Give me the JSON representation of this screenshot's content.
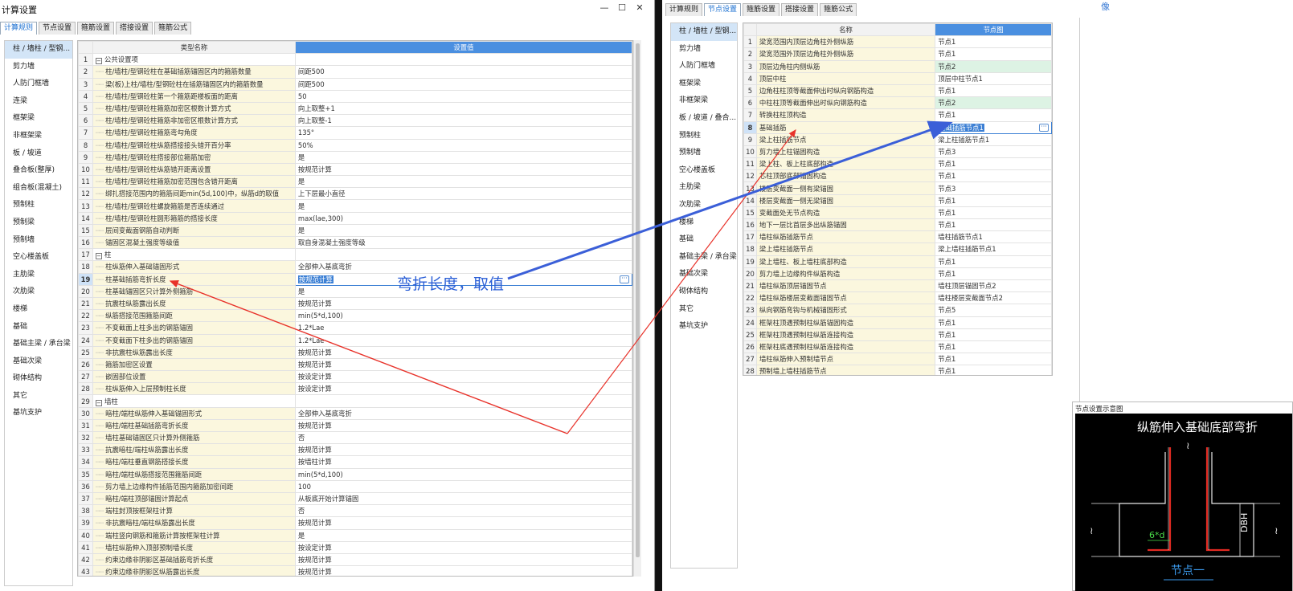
{
  "left_window": {
    "title": "计算设置",
    "controls": [
      "—",
      "☐",
      "✕"
    ],
    "tabs": [
      {
        "label": "计算规则",
        "active": true
      },
      {
        "label": "节点设置",
        "active": false
      },
      {
        "label": "箍筋设置",
        "active": false
      },
      {
        "label": "搭接设置",
        "active": false
      },
      {
        "label": "箍筋公式",
        "active": false
      }
    ],
    "sidebar": [
      "柱 / 墙柱 / 型钢...",
      "剪力墙",
      "人防门框墙",
      "连梁",
      "框架梁",
      "非框架梁",
      "板 / 坡道",
      "叠合板(整厚)",
      "组合板(混凝土)",
      "预制柱",
      "预制梁",
      "预制墙",
      "空心楼盖板",
      "主肋梁",
      "次肋梁",
      "楼梯",
      "基础",
      "基础主梁 / 承台梁",
      "基础次梁",
      "砌体结构",
      "其它",
      "基坑支护"
    ],
    "grid": {
      "col_name": "类型名称",
      "col_value": "设置值",
      "rows": [
        {
          "n": "1",
          "name": "公共设置项",
          "val": "",
          "group": true
        },
        {
          "n": "2",
          "name": "柱/墙柱/型钢砼柱在基础插筋锚固区内的箍筋数量",
          "val": "间距500"
        },
        {
          "n": "3",
          "name": "梁(板)上柱/墙柱/型钢砼柱在插筋锚固区内的箍筋数量",
          "val": "间距500"
        },
        {
          "n": "4",
          "name": "柱/墙柱/型钢砼柱第一个箍筋距楼板面的距离",
          "val": "50"
        },
        {
          "n": "5",
          "name": "柱/墙柱/型钢砼柱箍筋加密区根数计算方式",
          "val": "向上取整+1"
        },
        {
          "n": "6",
          "name": "柱/墙柱/型钢砼柱箍筋非加密区根数计算方式",
          "val": "向上取整-1"
        },
        {
          "n": "7",
          "name": "柱/墙柱/型钢砼柱箍筋弯勾角度",
          "val": "135°"
        },
        {
          "n": "8",
          "name": "柱/墙柱/型钢砼柱纵筋搭接接头错开百分率",
          "val": "50%"
        },
        {
          "n": "9",
          "name": "柱/墙柱/型钢砼柱搭接部位箍筋加密",
          "val": "是"
        },
        {
          "n": "10",
          "name": "柱/墙柱/型钢砼柱纵筋错开距离设置",
          "val": "按规范计算"
        },
        {
          "n": "11",
          "name": "柱/墙柱/型钢砼柱箍筋加密范围包含错开距离",
          "val": "是"
        },
        {
          "n": "12",
          "name": "绑扎搭接范围内的箍筋间距min(5d,100)中，纵筋d的取值",
          "val": "上下层最小直径"
        },
        {
          "n": "13",
          "name": "柱/墙柱/型钢砼柱螺旋箍筋是否连续通过",
          "val": "是"
        },
        {
          "n": "14",
          "name": "柱/墙柱/型钢砼柱圆形箍筋的搭接长度",
          "val": "max(lae,300)"
        },
        {
          "n": "15",
          "name": "层间变截面钢筋自动判断",
          "val": "是"
        },
        {
          "n": "16",
          "name": "锚固区混凝土强度等级值",
          "val": "取自身混凝土强度等级"
        },
        {
          "n": "17",
          "name": "柱",
          "val": "",
          "group": true
        },
        {
          "n": "18",
          "name": "柱纵筋伸入基础锚固形式",
          "val": "全部伸入基底弯折"
        },
        {
          "n": "19",
          "name": "柱基础插筋弯折长度",
          "val": "按规范计算",
          "selected": true
        },
        {
          "n": "20",
          "name": "柱基础锚固区只计算外侧箍筋",
          "val": "是"
        },
        {
          "n": "21",
          "name": "抗震柱纵筋露出长度",
          "val": "按规范计算"
        },
        {
          "n": "22",
          "name": "纵筋搭接范围箍筋间距",
          "val": "min(5*d,100)"
        },
        {
          "n": "23",
          "name": "不变截面上柱多出的钢筋锚固",
          "val": "1.2*Lae"
        },
        {
          "n": "24",
          "name": "不变截面下柱多出的钢筋锚固",
          "val": "1.2*Lae"
        },
        {
          "n": "25",
          "name": "非抗震柱纵筋露出长度",
          "val": "按规范计算"
        },
        {
          "n": "26",
          "name": "箍筋加密区设置",
          "val": "按规范计算"
        },
        {
          "n": "27",
          "name": "嵌固部位设置",
          "val": "按设定计算"
        },
        {
          "n": "28",
          "name": "柱纵筋伸入上层预制柱长度",
          "val": "按设定计算"
        },
        {
          "n": "29",
          "name": "墙柱",
          "val": "",
          "group": true
        },
        {
          "n": "30",
          "name": "暗柱/端柱纵筋伸入基础锚固形式",
          "val": "全部伸入基底弯折"
        },
        {
          "n": "31",
          "name": "暗柱/端柱基础插筋弯折长度",
          "val": "按规范计算"
        },
        {
          "n": "32",
          "name": "墙柱基础锚固区只计算外侧箍筋",
          "val": "否"
        },
        {
          "n": "33",
          "name": "抗震暗柱/端柱纵筋露出长度",
          "val": "按规范计算"
        },
        {
          "n": "34",
          "name": "暗柱/端柱垂直钢筋搭接长度",
          "val": "按墙柱计算"
        },
        {
          "n": "35",
          "name": "暗柱/端柱纵筋搭接范围箍筋间距",
          "val": "min(5*d,100)"
        },
        {
          "n": "36",
          "name": "剪力墙上边缘构件插筋范围内箍筋加密间距",
          "val": "100"
        },
        {
          "n": "37",
          "name": "暗柱/端柱顶部锚固计算起点",
          "val": "从板底开始计算锚固"
        },
        {
          "n": "38",
          "name": "端柱封顶按框架柱计算",
          "val": "否"
        },
        {
          "n": "39",
          "name": "非抗震暗柱/端柱纵筋露出长度",
          "val": "按规范计算"
        },
        {
          "n": "40",
          "name": "端柱竖向钢筋和箍筋计算按框架柱计算",
          "val": "是"
        },
        {
          "n": "41",
          "name": "墙柱纵筋伸入顶部预制墙长度",
          "val": "按设定计算"
        },
        {
          "n": "42",
          "name": "约束边缘非阴影区基础插筋弯折长度",
          "val": "按规范计算"
        },
        {
          "n": "43",
          "name": "约束边缘非阴影区纵筋露出长度",
          "val": "按规范计算"
        }
      ]
    }
  },
  "right_window": {
    "corner_text": "像",
    "tabs": [
      {
        "label": "计算规则",
        "active": false
      },
      {
        "label": "节点设置",
        "active": true
      },
      {
        "label": "箍筋设置",
        "active": false
      },
      {
        "label": "搭接设置",
        "active": false
      },
      {
        "label": "箍筋公式",
        "active": false
      }
    ],
    "sidebar": [
      "柱 / 墙柱 / 型钢...",
      "剪力墙",
      "人防门框墙",
      "框架梁",
      "非框架梁",
      "板 / 坡道 / 叠合...",
      "预制柱",
      "预制墙",
      "空心楼盖板",
      "主肋梁",
      "次肋梁",
      "楼梯",
      "基础",
      "基础主梁 / 承台梁",
      "基础次梁",
      "砌体结构",
      "其它",
      "基坑支护"
    ],
    "grid": {
      "col_name": "名称",
      "col_value": "节点图",
      "rows": [
        {
          "n": "1",
          "name": "梁宽范围内顶层边角柱外侧纵筋",
          "val": "节点1"
        },
        {
          "n": "2",
          "name": "梁宽范围外顶层边角柱外侧纵筋",
          "val": "节点1"
        },
        {
          "n": "3",
          "name": "顶层边角柱内侧纵筋",
          "val": "节点2",
          "green": true
        },
        {
          "n": "4",
          "name": "顶层中柱",
          "val": "顶层中柱节点1"
        },
        {
          "n": "5",
          "name": "边角柱柱顶等截面伸出时纵向钢筋构造",
          "val": "节点1"
        },
        {
          "n": "6",
          "name": "中柱柱顶等截面伸出时纵向钢筋构造",
          "val": "节点2",
          "green": true
        },
        {
          "n": "7",
          "name": "转换柱柱顶构造",
          "val": "节点1"
        },
        {
          "n": "8",
          "name": "基础插筋",
          "val": "基础插筋节点1",
          "selected": true
        },
        {
          "n": "9",
          "name": "梁上柱插筋节点",
          "val": "梁上柱插筋节点1"
        },
        {
          "n": "10",
          "name": "剪力墙上柱锚固构造",
          "val": "节点3"
        },
        {
          "n": "11",
          "name": "梁上柱、板上柱底部构造",
          "val": "节点1"
        },
        {
          "n": "12",
          "name": "芯柱顶部底部锚固构造",
          "val": "节点1"
        },
        {
          "n": "13",
          "name": "楼层变截面一侧有梁锚固",
          "val": "节点3"
        },
        {
          "n": "14",
          "name": "楼层变截面一侧无梁锚固",
          "val": "节点1"
        },
        {
          "n": "15",
          "name": "变截面处无节点构造",
          "val": "节点1"
        },
        {
          "n": "16",
          "name": "地下一层比首层多出纵筋锚固",
          "val": "节点1"
        },
        {
          "n": "17",
          "name": "墙柱纵筋插筋节点",
          "val": "墙柱插筋节点1"
        },
        {
          "n": "18",
          "name": "梁上墙柱插筋节点",
          "val": "梁上墙柱插筋节点1"
        },
        {
          "n": "19",
          "name": "梁上墙柱、板上墙柱底部构造",
          "val": "节点1"
        },
        {
          "n": "20",
          "name": "剪力墙上边缘构件纵筋构造",
          "val": "节点1"
        },
        {
          "n": "21",
          "name": "墙柱纵筋顶层锚固节点",
          "val": "墙柱顶层锚固节点2"
        },
        {
          "n": "22",
          "name": "墙柱纵筋楼层变截面锚固节点",
          "val": "墙柱楼层变截面节点2"
        },
        {
          "n": "23",
          "name": "纵向钢筋弯钩与机械锚固形式",
          "val": "节点5"
        },
        {
          "n": "24",
          "name": "框架柱顶遇预制柱纵筋锚固构造",
          "val": "节点1"
        },
        {
          "n": "25",
          "name": "框架柱顶遇预制柱纵筋连接构造",
          "val": "节点1"
        },
        {
          "n": "26",
          "name": "框架柱底遇预制柱纵筋连接构造",
          "val": "节点1"
        },
        {
          "n": "27",
          "name": "墙柱纵筋伸入预制墙节点",
          "val": "节点1"
        },
        {
          "n": "28",
          "name": "预制墙上墙柱插筋节点",
          "val": "节点1"
        }
      ]
    },
    "preview": {
      "title": "节点设置示意图",
      "heading": "纵筋伸入基础底部弯折",
      "dim_6d": "6*d",
      "dim_dbh": "DBH",
      "caption": "节点一"
    }
  },
  "annotation": {
    "text": "弯折长度，取值",
    "arrow_color": "#3b5fd8",
    "red_line_color": "#e8322a"
  }
}
